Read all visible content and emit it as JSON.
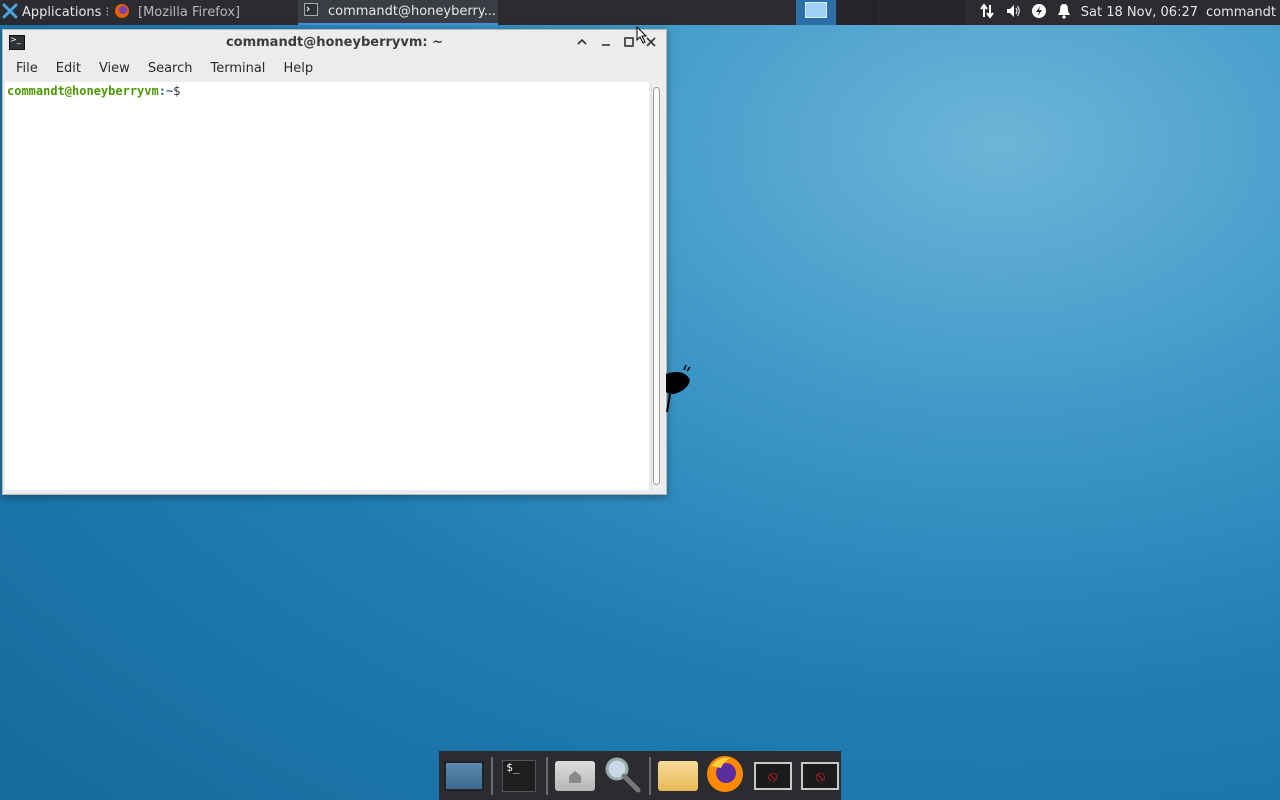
{
  "top_panel": {
    "applications_label": "Applications",
    "firefox_task_label": "[Mozilla Firefox]",
    "terminal_task_label": "commandt@honeyberry...",
    "clock": "Sat 18 Nov, 06:27",
    "user": "commandt"
  },
  "terminal": {
    "title": "commandt@honeyberryvm: ~",
    "menu": [
      "File",
      "Edit",
      "View",
      "Search",
      "Terminal",
      "Help"
    ],
    "prompt_user": "commandt@honeyberryvm",
    "prompt_path": ":~",
    "prompt_sign": "$"
  },
  "dock": {
    "terminal_glyph": "$_"
  },
  "icons": {
    "apps_icon": "xfce-x-icon",
    "firefox_icon": "firefox-icon",
    "terminal_icon": "terminal-icon",
    "network_icon": "network-updown-icon",
    "volume_icon": "volume-icon",
    "power_icon": "power-icon",
    "notification_icon": "bell-icon"
  },
  "colors": {
    "prompt_user": "#4e9a06",
    "prompt_path": "#3465a4",
    "panel_bg": "#2a2c30",
    "active_workspace": "#2b6ea8"
  }
}
